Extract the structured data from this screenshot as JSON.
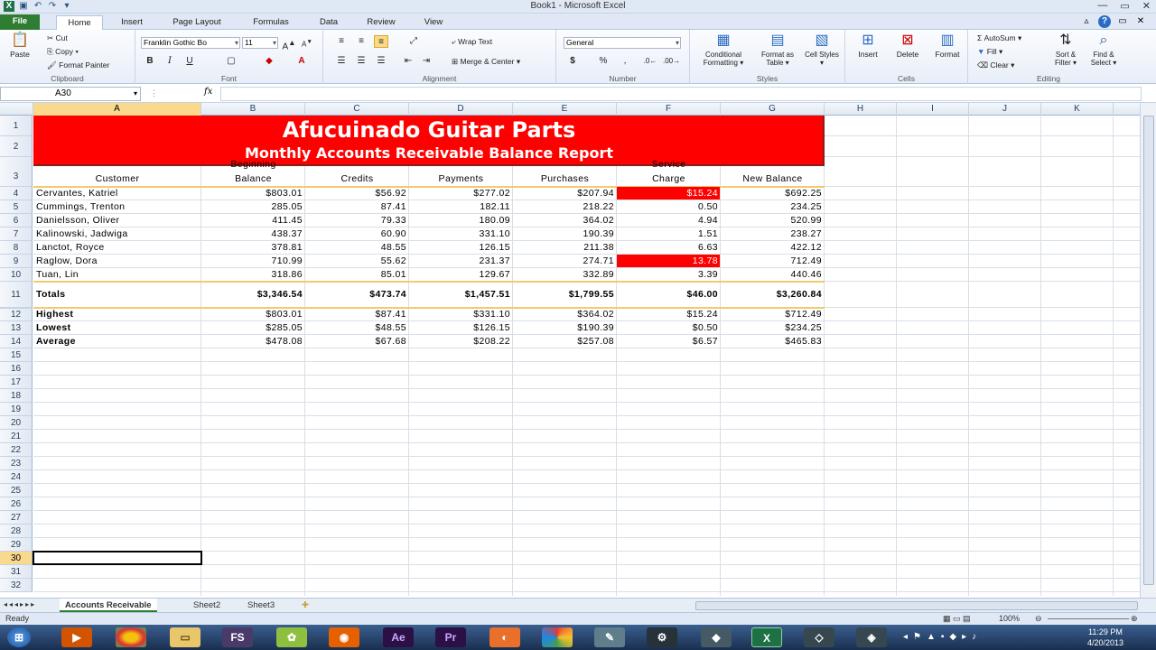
{
  "window": {
    "title": "Book1 - Microsoft Excel"
  },
  "tabs": [
    "File",
    "Home",
    "Insert",
    "Page Layout",
    "Formulas",
    "Data",
    "Review",
    "View"
  ],
  "ribbon": {
    "clipboard": {
      "paste": "Paste",
      "cut": "Cut",
      "copy": "Copy ▾",
      "format_painter": "Format Painter",
      "label": "Clipboard"
    },
    "font": {
      "name": "Franklin Gothic Bo",
      "size": "11",
      "label": "Font",
      "bold": "B",
      "italic": "I",
      "underline": "U"
    },
    "alignment": {
      "wrap": "Wrap Text",
      "merge": "Merge & Center ▾",
      "label": "Alignment"
    },
    "number": {
      "format": "General",
      "label": "Number",
      "currency": "$",
      "percent": "%",
      "comma": ","
    },
    "styles": {
      "conditional": "Conditional Formatting ▾",
      "format_table": "Format as Table ▾",
      "cell_styles": "Cell Styles ▾",
      "label": "Styles"
    },
    "cells": {
      "insert": "Insert",
      "delete": "Delete",
      "format": "Format",
      "label": "Cells"
    },
    "editing": {
      "autosum": "AutoSum ▾",
      "fill": "Fill ▾",
      "clear": "Clear ▾",
      "sort": "Sort & Filter ▾",
      "find": "Find & Select ▾",
      "label": "Editing"
    }
  },
  "formula_bar": {
    "name_box": "A30",
    "fx": "fx",
    "content": ""
  },
  "columns": [
    "A",
    "B",
    "C",
    "D",
    "E",
    "F",
    "G",
    "H",
    "I",
    "J",
    "K"
  ],
  "sheet": {
    "title1": "Afucuinado Guitar Parts",
    "title2": "Monthly Accounts Receivable Balance Report",
    "headers": {
      "a": "Customer",
      "b1": "Beginning",
      "b2": "Balance",
      "c": "Credits",
      "d": "Payments",
      "e": "Purchases",
      "f1": "Service",
      "f2": "Charge",
      "g": "New Balance"
    },
    "rows": [
      [
        "Cervantes, Katriel",
        "$803.01",
        "$56.92",
        "$277.02",
        "$207.94",
        "$15.24",
        "$692.25"
      ],
      [
        "Cummings, Trenton",
        "285.05",
        "87.41",
        "182.11",
        "218.22",
        "0.50",
        "234.25"
      ],
      [
        "Danielsson, Oliver",
        "411.45",
        "79.33",
        "180.09",
        "364.02",
        "4.94",
        "520.99"
      ],
      [
        "Kalinowski, Jadwiga",
        "438.37",
        "60.90",
        "331.10",
        "190.39",
        "1.51",
        "238.27"
      ],
      [
        "Lanctot, Royce",
        "378.81",
        "48.55",
        "126.15",
        "211.38",
        "6.63",
        "422.12"
      ],
      [
        "Raglow, Dora",
        "710.99",
        "55.62",
        "231.37",
        "274.71",
        "13.78",
        "712.49"
      ],
      [
        "Tuan, Lin",
        "318.86",
        "85.01",
        "129.67",
        "332.89",
        "3.39",
        "440.46"
      ]
    ],
    "totals": [
      "Totals",
      "$3,346.54",
      "$473.74",
      "$1,457.51",
      "$1,799.55",
      "$46.00",
      "$3,260.84"
    ],
    "stats": [
      [
        "Highest",
        "$803.01",
        "$87.41",
        "$331.10",
        "$364.02",
        "$15.24",
        "$712.49"
      ],
      [
        "Lowest",
        "$285.05",
        "$48.55",
        "$126.15",
        "$190.39",
        "$0.50",
        "$234.25"
      ],
      [
        "Average",
        "$478.08",
        "$67.68",
        "$208.22",
        "$257.08",
        "$6.57",
        "$465.83"
      ]
    ],
    "row_numbers": [
      "1",
      "2",
      "3",
      "4",
      "5",
      "6",
      "7",
      "8",
      "9",
      "10",
      "11",
      "12",
      "13",
      "14",
      "15",
      "16",
      "17",
      "18",
      "19",
      "20",
      "21",
      "22",
      "23",
      "24",
      "25",
      "26",
      "27",
      "28",
      "29",
      "30",
      "31",
      "32"
    ],
    "active_row": "30"
  },
  "sheet_tabs": [
    "Accounts Receivable",
    "Sheet2",
    "Sheet3"
  ],
  "status": {
    "ready": "Ready",
    "zoom": "100%"
  },
  "taskbar": {
    "time": "11:29 PM",
    "date": "4/20/2013",
    "apps": [
      "FS",
      "Ae",
      "Pr"
    ]
  }
}
